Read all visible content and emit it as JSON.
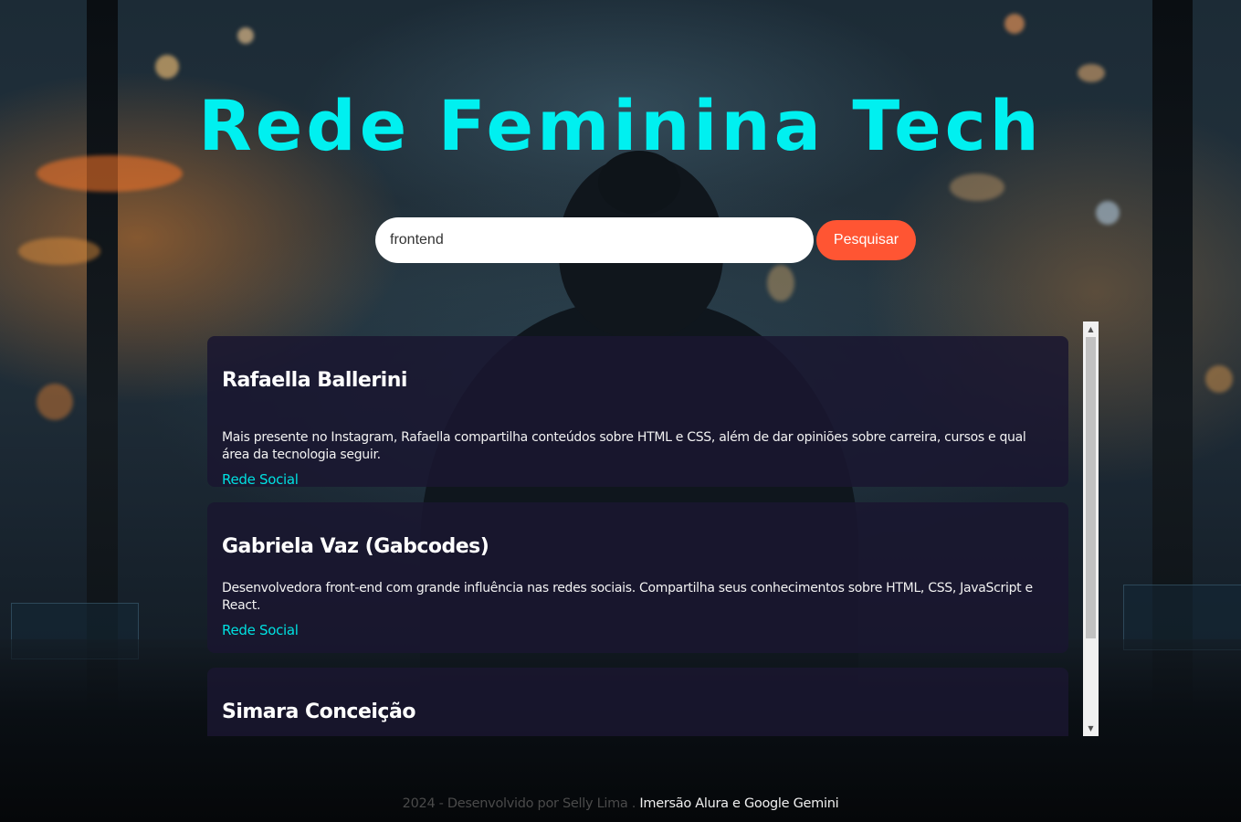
{
  "header": {
    "title": "Rede Feminina Tech"
  },
  "search": {
    "value": "frontend",
    "button_label": "Pesquisar"
  },
  "results": [
    {
      "name": "Rafaella Ballerini",
      "description": "Mais presente no Instagram, Rafaella compartilha conteúdos sobre HTML e CSS, além de dar opiniões sobre carreira, cursos e qual área da tecnologia seguir.",
      "link_label": "Rede Social"
    },
    {
      "name": "Gabriela Vaz (Gabcodes)",
      "description": "Desenvolvedora front-end com grande influência nas redes sociais. Compartilha seus conhecimentos sobre HTML, CSS, JavaScript e React.",
      "link_label": "Rede Social"
    },
    {
      "name": "Simara Conceição"
    }
  ],
  "footer": {
    "credit": "2024 - Desenvolvido por Selly Lima .",
    "highlight": " Imersão Alura e Google Gemini"
  },
  "theme": {
    "title_color": "#00f0f0",
    "button_color": "#ff5533",
    "link_color": "#00e0e0",
    "card_color": "#1a1630"
  },
  "icons": {
    "scroll_up": "triangle-up-icon",
    "scroll_down": "triangle-down-icon"
  }
}
